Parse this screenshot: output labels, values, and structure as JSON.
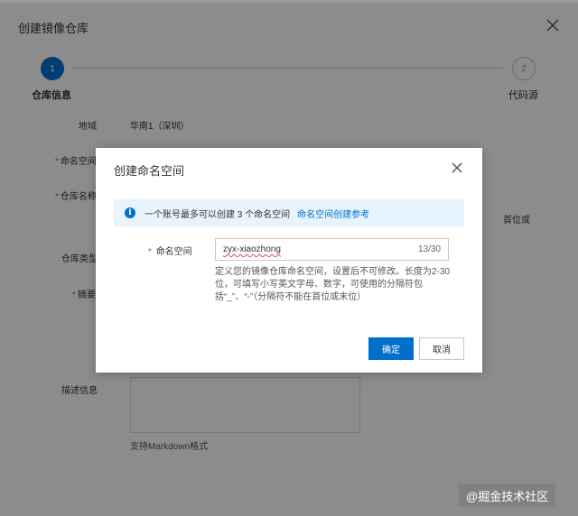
{
  "panel": {
    "title": "创建镜像仓库",
    "steps": [
      {
        "number": "1",
        "label": "仓库信息"
      },
      {
        "number": "2",
        "label": "代码源"
      }
    ],
    "fields": {
      "region_label": "地域",
      "region_value": "华南1（深圳）",
      "namespace_label": "命名空间",
      "repo_name_label": "仓库名称",
      "repo_type_label": "仓库类型",
      "summary_label": "摘要",
      "description_label": "描述信息",
      "right_fragment": "首位或",
      "markdown_hint": "支持Markdown格式"
    }
  },
  "dialog": {
    "title": "创建命名空间",
    "notice_text": "一个账号最多可以创建 3 个命名空间",
    "notice_link": "命名空间创建参考",
    "field_label": "命名空间",
    "field_value": "zyx-xiaozhong",
    "field_count": "13/30",
    "help_text": "定义您的镜像仓库命名空间，设置后不可修改。长度为2-30位，可填写小写英文字母、数字，可使用的分隔符包括“_”、“-”（分隔符不能在首位或末位）",
    "ok_label": "确定",
    "cancel_label": "取消"
  },
  "watermark": "@掘金技术社区",
  "colors": {
    "primary": "#0070cc",
    "required": "#e0455a",
    "notice_bg": "#e8f4fd"
  }
}
